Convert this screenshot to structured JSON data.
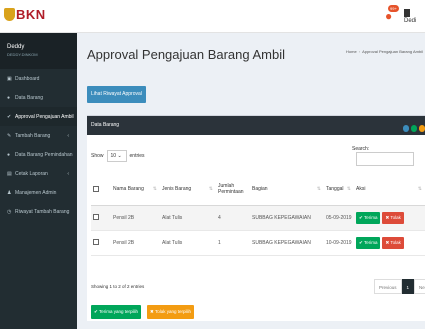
{
  "topbar": {
    "logo_text": "BKN",
    "notif_count": "99+",
    "user_short": "Dedi"
  },
  "sidebar": {
    "user_name": "Deddy",
    "user_sub": "DEDDY.DINKOM",
    "items": [
      {
        "label": "Dashboard",
        "icon": "dashboard-icon",
        "chev": ""
      },
      {
        "label": "Data Barang",
        "icon": "circle-icon",
        "chev": ""
      },
      {
        "label": "Approval Pengajuan Ambil",
        "icon": "check-icon",
        "chev": ""
      },
      {
        "label": "Tambah Barang",
        "icon": "pencil-icon",
        "chev": "‹"
      },
      {
        "label": "Data Barang Pemindahan",
        "icon": "circle-icon",
        "chev": ""
      },
      {
        "label": "Cetak Laporan",
        "icon": "print-icon",
        "chev": "‹"
      },
      {
        "label": "Manajemen Admin",
        "icon": "user-icon",
        "chev": ""
      },
      {
        "label": "Riwayat Tambah Barang",
        "icon": "history-icon",
        "chev": ""
      }
    ]
  },
  "page": {
    "title": "Approval Pengajuan Barang Ambil",
    "breadcrumb_home": "Home",
    "breadcrumb_current": "Approval Pengajuan Barang Ambil",
    "history_button": "Lihat Riwayat Approval"
  },
  "card": {
    "title": "Data Barang",
    "show_label": "Show",
    "show_value": "10",
    "entries_label": "entries",
    "search_label": "Search:",
    "columns": [
      "",
      "Nama Barang",
      "Jenis Barang",
      "Jumlah Permintaan",
      "Bagian",
      "Tanggal",
      "Aksi"
    ],
    "rows": [
      {
        "nama": "Pensil 2B",
        "jenis": "Alat Tulis",
        "jumlah": "4",
        "bagian": "SUBBAG KEPEGAWAIAN",
        "tanggal": "05-09-2019",
        "approve": "✔ Terima",
        "reject": "✖ Tolak"
      },
      {
        "nama": "Pensil 2B",
        "jenis": "Alat Tulis",
        "jumlah": "1",
        "bagian": "SUBBAG KEPEGAWAIAN",
        "tanggal": "10-09-2019",
        "approve": "✔ Terima",
        "reject": "✖ Tolak"
      }
    ],
    "info": "Showing 1 to 2 of 2 entries",
    "pager": {
      "prev": "Previous",
      "current": "1",
      "next": "Next"
    },
    "bulk_approve": "✔ Terima yang terpilih",
    "bulk_reject": "✖ Tolak yang terpilih"
  },
  "colors": {
    "primary": "#3c8dbc",
    "success": "#00a65a",
    "danger": "#dd4b39",
    "warning": "#f39c12",
    "sidebar": "#222d32"
  }
}
